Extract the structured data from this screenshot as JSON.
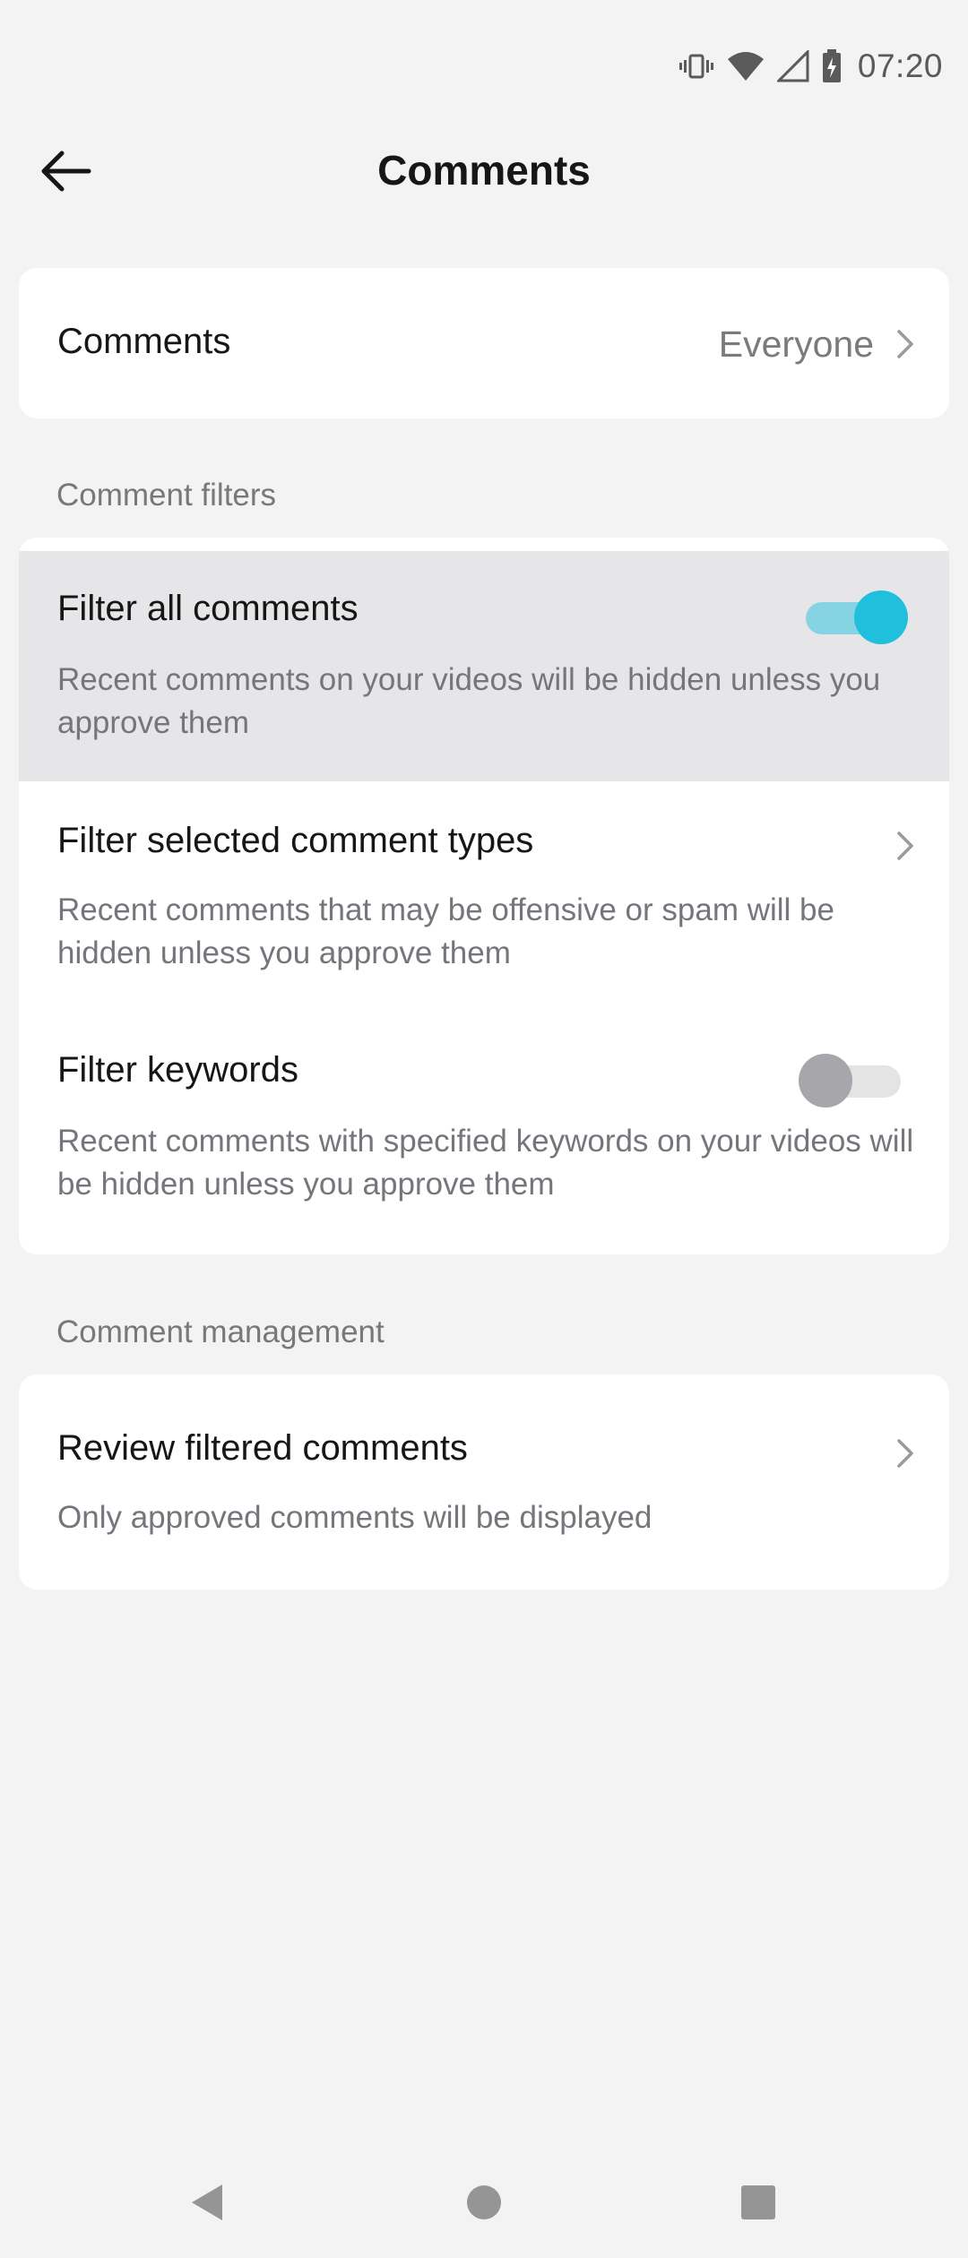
{
  "status_bar": {
    "time": "07:20",
    "icons": [
      "vibrate-icon",
      "wifi-icon",
      "cell-signal-icon",
      "battery-charging-icon"
    ]
  },
  "header": {
    "title": "Comments",
    "back_icon": "arrow-left-icon"
  },
  "comments_setting": {
    "label": "Comments",
    "value": "Everyone"
  },
  "comment_filters": {
    "section_label": "Comment filters",
    "items": [
      {
        "title": "Filter all comments",
        "description": "Recent comments on your videos will be hidden unless you approve them",
        "control": "toggle",
        "enabled": true
      },
      {
        "title": "Filter selected comment types",
        "description": "Recent comments that may be offensive or spam will be hidden unless you approve them",
        "control": "chevron"
      },
      {
        "title": "Filter keywords",
        "description": "Recent comments with specified keywords on your videos will be hidden unless you approve them",
        "control": "toggle",
        "enabled": false
      }
    ]
  },
  "comment_management": {
    "section_label": "Comment management",
    "items": [
      {
        "title": "Review filtered comments",
        "description": "Only approved comments will be displayed",
        "control": "chevron"
      }
    ]
  },
  "colors": {
    "accent": "#20bfdc",
    "accent_track": "#86d4e3",
    "background": "#f3f3f3",
    "card": "#ffffff",
    "highlight_row": "#e6e6e8"
  },
  "nav_bar": {
    "buttons": [
      "back-triangle-icon",
      "home-circle-icon",
      "recents-square-icon"
    ]
  }
}
